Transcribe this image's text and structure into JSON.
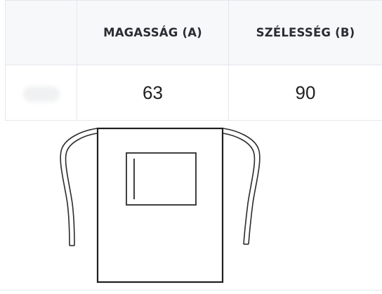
{
  "table": {
    "headers": [
      "",
      "MAGASSÁG (A)",
      "SZÉLESSÉG (B)"
    ],
    "rows": [
      [
        "",
        "63",
        "90"
      ]
    ]
  },
  "illustration": {
    "icon": "apron-outline-icon"
  }
}
